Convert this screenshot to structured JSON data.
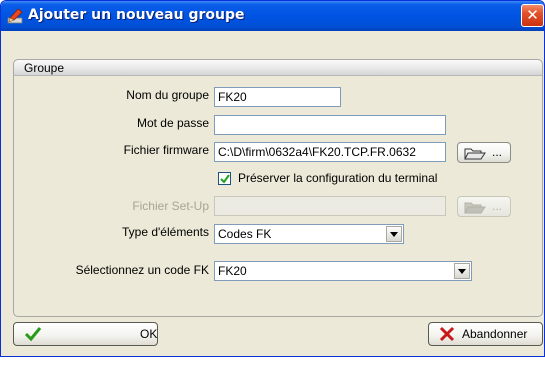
{
  "window": {
    "title": "Ajouter un nouveau groupe",
    "close_glyph": "✕",
    "app_icon": "pencil-app-icon",
    "close_icon": "close-icon"
  },
  "group": {
    "header": "Groupe",
    "fields": {
      "group_name": {
        "label": "Nom du groupe",
        "value": "FK20"
      },
      "password": {
        "label": "Mot de passe",
        "value": ""
      },
      "firmware_file": {
        "label": "Fichier firmware",
        "value": "C:\\D\\firm\\0632a4\\FK20.TCP.FR.0632",
        "browse_label": "..."
      },
      "preserve_config": {
        "label": "Préserver la configuration du terminal",
        "checked": true
      },
      "setup_file": {
        "label": "Fichier Set-Up",
        "value": "",
        "browse_label": "...",
        "disabled": true
      },
      "element_type": {
        "label": "Type d'éléments",
        "value": "Codes FK"
      },
      "fk_code": {
        "label": "Sélectionnez un code FK",
        "value": "FK20"
      }
    }
  },
  "buttons": {
    "ok_label": "OK",
    "cancel_label": "Abandonner",
    "ok_icon": "checkmark-icon",
    "cancel_icon": "red-x-icon"
  },
  "colors": {
    "titlebar": "#0054e3",
    "close": "#e2502a",
    "dialog_bg": "#ece9d8"
  }
}
